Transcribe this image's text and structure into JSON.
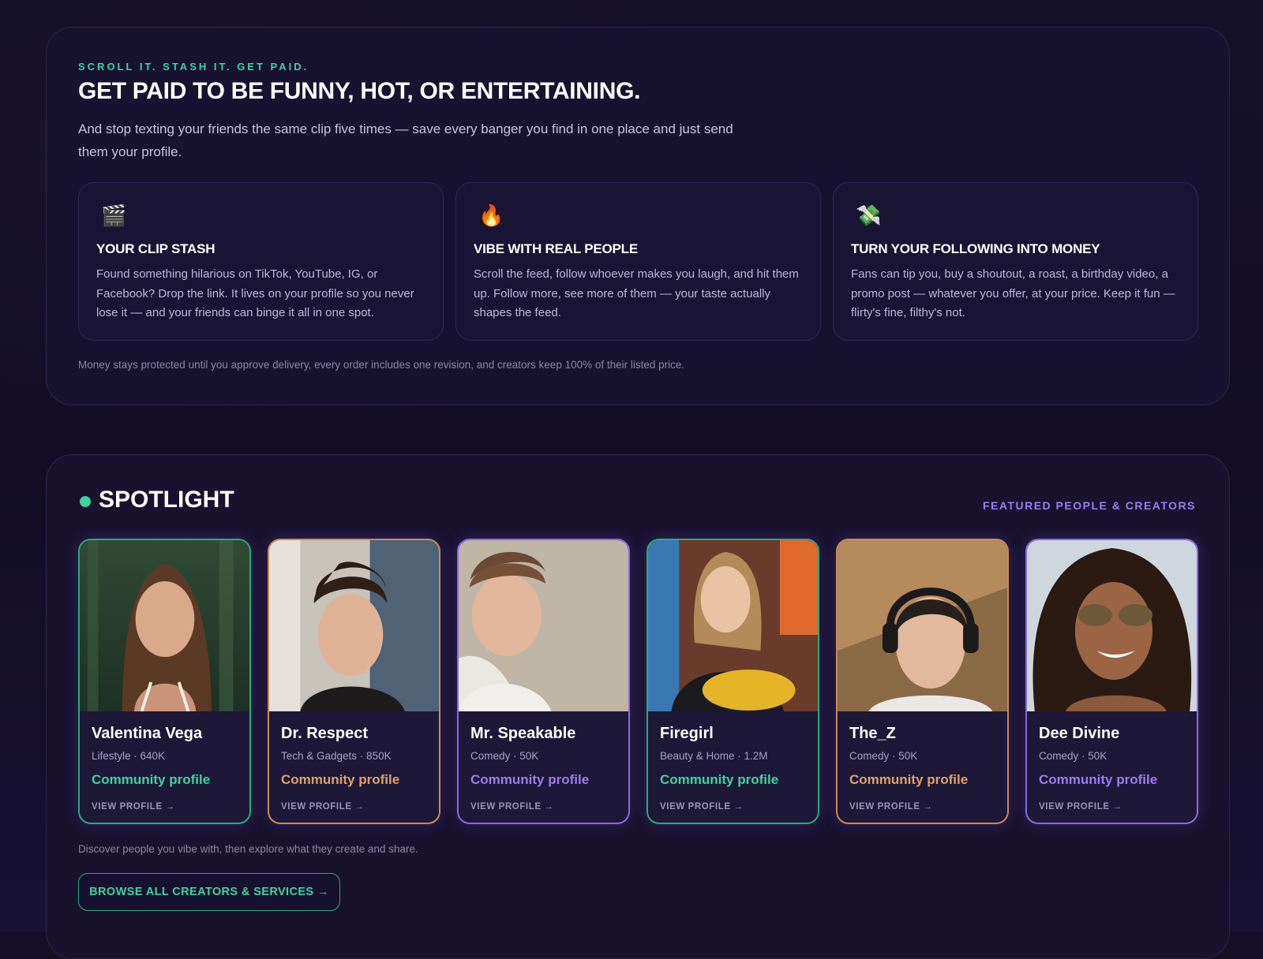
{
  "intro": {
    "eyebrow": "SCROLL IT. STASH IT. GET PAID.",
    "headline": "GET PAID TO BE FUNNY, HOT, OR ENTERTAINING.",
    "subhead": "And stop texting your friends the same clip five times — save every banger you find in one place and just send them your profile.",
    "features": [
      {
        "icon": "clapperboard-icon",
        "glyph": "🎬",
        "title": "YOUR CLIP STASH",
        "body": "Found something hilarious on TikTok, YouTube, IG, or Facebook? Drop the link. It lives on your profile so you never lose it — and your friends can binge it all in one spot."
      },
      {
        "icon": "fire-icon",
        "glyph": "🔥",
        "title": "VIBE WITH REAL PEOPLE",
        "body": "Scroll the feed, follow whoever makes you laugh, and hit them up. Follow more, see more of them — your taste actually shapes the feed."
      },
      {
        "icon": "money-wings-icon",
        "glyph": "💸",
        "title": "TURN YOUR FOLLOWING INTO MONEY",
        "body": "Fans can tip you, buy a shoutout, a roast, a birthday video, a promo post — whatever you offer, at your price. Keep it fun — flirty's fine, filthy's not."
      }
    ],
    "footnote": "Money stays protected until you approve delivery, every order includes one revision, and creators keep 100% of their listed price."
  },
  "spotlight": {
    "title": "SPOTLIGHT",
    "eyebrow": "FEATURED PEOPLE & CREATORS",
    "creators": [
      {
        "name": "Valentina Vega",
        "meta": "Lifestyle · 640K",
        "badge": "Community profile",
        "view": "VIEW PROFILE →",
        "accent": "#3fd49a"
      },
      {
        "name": "Dr. Respect",
        "meta": "Tech & Gadgets · 850K",
        "badge": "Community profile",
        "view": "VIEW PROFILE →",
        "accent": "#e0a164"
      },
      {
        "name": "Mr. Speakable",
        "meta": "Comedy · 50K",
        "badge": "Community profile",
        "view": "VIEW PROFILE →",
        "accent": "#9b7cf2"
      },
      {
        "name": "Firegirl",
        "meta": "Beauty & Home · 1.2M",
        "badge": "Community profile",
        "view": "VIEW PROFILE →",
        "accent": "#3fd49a"
      },
      {
        "name": "The_Z",
        "meta": "Comedy · 50K",
        "badge": "Community profile",
        "view": "VIEW PROFILE →",
        "accent": "#e0a164"
      },
      {
        "name": "Dee Divine",
        "meta": "Comedy · 50K",
        "badge": "Community profile",
        "view": "VIEW PROFILE →",
        "accent": "#9b7cf2"
      }
    ],
    "footnote": "Discover people you vibe with, then explore what they create and share.",
    "browse_label": "BROWSE ALL CREATORS & SERVICES →"
  },
  "colors": {
    "accent_green": "#3fd49a",
    "accent_orange": "#e0a164",
    "accent_purple": "#9b7cf2",
    "background": "#140f26"
  }
}
